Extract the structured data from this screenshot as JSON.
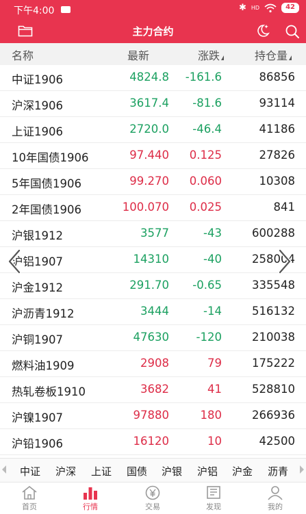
{
  "status_bar": {
    "time": "下午4:00",
    "bluetooth": "✱",
    "network": "HD",
    "battery": "42"
  },
  "header": {
    "title": "主力合约"
  },
  "table": {
    "headers": {
      "name": "名称",
      "last": "最新",
      "change": "涨跌",
      "open_interest": "持仓量"
    },
    "rows": [
      {
        "name": "中证1906",
        "last": "4824.8",
        "change": "-161.6",
        "oi": "86856",
        "dir": "down"
      },
      {
        "name": "沪深1906",
        "last": "3617.4",
        "change": "-81.6",
        "oi": "93114",
        "dir": "down"
      },
      {
        "name": "上证1906",
        "last": "2720.0",
        "change": "-46.4",
        "oi": "41186",
        "dir": "down"
      },
      {
        "name": "10年国债1906",
        "last": "97.440",
        "change": "0.125",
        "oi": "27826",
        "dir": "up"
      },
      {
        "name": "5年国债1906",
        "last": "99.270",
        "change": "0.060",
        "oi": "10308",
        "dir": "up"
      },
      {
        "name": "2年国债1906",
        "last": "100.070",
        "change": "0.025",
        "oi": "841",
        "dir": "up"
      },
      {
        "name": "沪银1912",
        "last": "3577",
        "change": "-43",
        "oi": "600288",
        "dir": "down"
      },
      {
        "name": "沪铝1907",
        "last": "14310",
        "change": "-40",
        "oi": "258004",
        "dir": "down"
      },
      {
        "name": "沪金1912",
        "last": "291.70",
        "change": "-0.65",
        "oi": "335548",
        "dir": "down"
      },
      {
        "name": "沪沥青1912",
        "last": "3444",
        "change": "-14",
        "oi": "516132",
        "dir": "down"
      },
      {
        "name": "沪铜1907",
        "last": "47630",
        "change": "-120",
        "oi": "210038",
        "dir": "down"
      },
      {
        "name": "燃料油1909",
        "last": "2908",
        "change": "79",
        "oi": "175222",
        "dir": "up"
      },
      {
        "name": "热轧卷板1910",
        "last": "3682",
        "change": "41",
        "oi": "528810",
        "dir": "up"
      },
      {
        "name": "沪镍1907",
        "last": "97880",
        "change": "180",
        "oi": "266936",
        "dir": "up"
      },
      {
        "name": "沪铅1906",
        "last": "16120",
        "change": "10",
        "oi": "42500",
        "dir": "up"
      }
    ]
  },
  "categories": [
    "中证",
    "沪深",
    "上证",
    "国债",
    "沪银",
    "沪铝",
    "沪金",
    "沥青"
  ],
  "nav": {
    "home": "首页",
    "market": "行情",
    "trade": "交易",
    "discover": "发现",
    "mine": "我的"
  },
  "colors": {
    "brand": "#e8344f",
    "up": "#dd2c47",
    "down": "#1ba060"
  }
}
